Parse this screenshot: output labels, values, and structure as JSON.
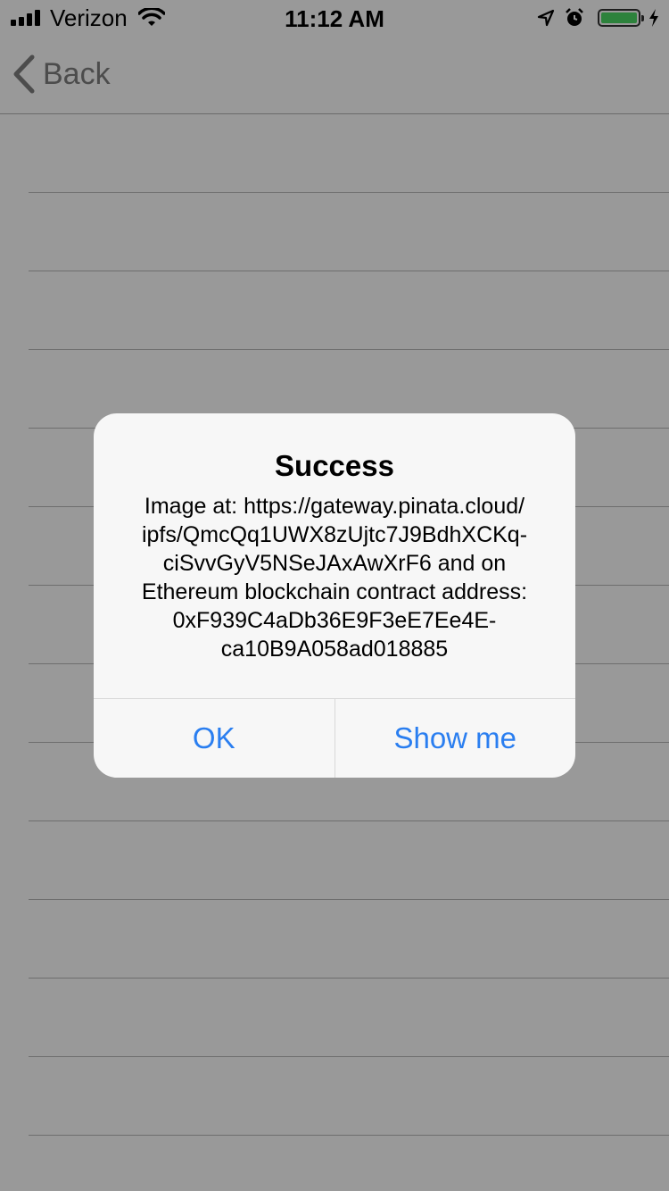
{
  "status_bar": {
    "carrier": "Verizon",
    "time": "11:12 AM",
    "icons": [
      "signal-icon",
      "wifi-icon",
      "location-arrow-icon",
      "alarm-icon",
      "battery-icon",
      "charging-bolt-icon"
    ],
    "battery_color": "#4cd964"
  },
  "nav": {
    "back_label": "Back"
  },
  "table": {
    "row_count_visible": 13
  },
  "alert": {
    "title": "Success",
    "message_lines": [
      "Image at: https://gateway.pinata.cloud/",
      "ipfs/QmcQq1UWX8zUjtc7J9BdhXCKq-",
      "ciSvvGyV5NSeJAxAwXrF6 and on",
      "Ethereum blockchain contract address:",
      "0xF939C4aDb36E9F3eE7Ee4E-",
      "ca10B9A058ad018885"
    ],
    "actions": [
      {
        "label": "OK"
      },
      {
        "label": "Show me"
      }
    ],
    "action_color": "#2a7ef0"
  }
}
